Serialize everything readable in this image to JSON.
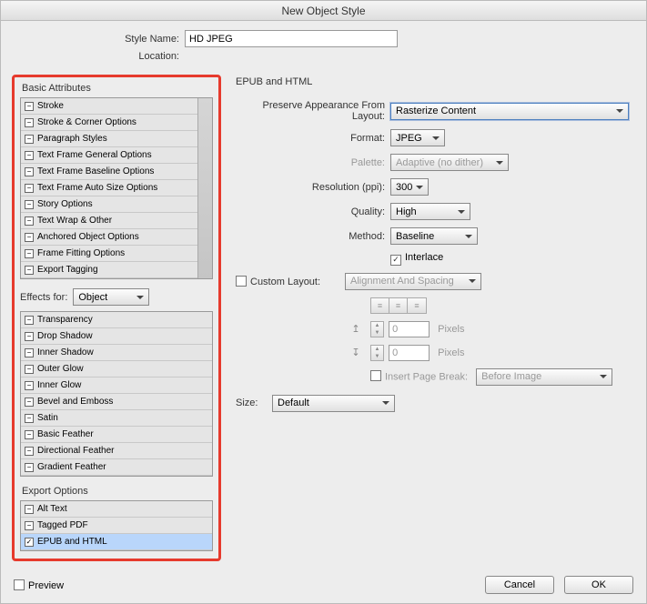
{
  "window": {
    "title": "New Object Style"
  },
  "top": {
    "style_name_label": "Style Name:",
    "style_name_value": "HD JPEG",
    "location_label": "Location:"
  },
  "sidebar": {
    "basic_title": "Basic Attributes",
    "basic_items": [
      {
        "label": "Stroke",
        "mark": "-"
      },
      {
        "label": "Stroke & Corner Options",
        "mark": "-"
      },
      {
        "label": "Paragraph Styles",
        "mark": "-"
      },
      {
        "label": "Text Frame General Options",
        "mark": "-"
      },
      {
        "label": "Text Frame Baseline Options",
        "mark": "-"
      },
      {
        "label": "Text Frame Auto Size Options",
        "mark": "-"
      },
      {
        "label": "Story Options",
        "mark": "-"
      },
      {
        "label": "Text Wrap & Other",
        "mark": "-"
      },
      {
        "label": "Anchored Object Options",
        "mark": "-"
      },
      {
        "label": "Frame Fitting Options",
        "mark": "-"
      },
      {
        "label": "Export Tagging",
        "mark": "-"
      }
    ],
    "effects_for_label": "Effects for:",
    "effects_for_value": "Object",
    "effect_items": [
      {
        "label": "Transparency",
        "mark": "-"
      },
      {
        "label": "Drop Shadow",
        "mark": "-"
      },
      {
        "label": "Inner Shadow",
        "mark": "-"
      },
      {
        "label": "Outer Glow",
        "mark": "-"
      },
      {
        "label": "Inner Glow",
        "mark": "-"
      },
      {
        "label": "Bevel and Emboss",
        "mark": "-"
      },
      {
        "label": "Satin",
        "mark": "-"
      },
      {
        "label": "Basic Feather",
        "mark": "-"
      },
      {
        "label": "Directional Feather",
        "mark": "-"
      },
      {
        "label": "Gradient Feather",
        "mark": "-"
      }
    ],
    "export_title": "Export Options",
    "export_items": [
      {
        "label": "Alt Text",
        "mark": "-",
        "selected": false
      },
      {
        "label": "Tagged PDF",
        "mark": "-",
        "selected": false
      },
      {
        "label": "EPUB and HTML",
        "mark": "✓",
        "selected": true
      }
    ]
  },
  "panel": {
    "title": "EPUB and HTML",
    "preserve_label": "Preserve Appearance From Layout:",
    "preserve_value": "Rasterize Content",
    "format_label": "Format:",
    "format_value": "JPEG",
    "palette_label": "Palette:",
    "palette_value": "Adaptive (no dither)",
    "resolution_label": "Resolution (ppi):",
    "resolution_value": "300",
    "quality_label": "Quality:",
    "quality_value": "High",
    "method_label": "Method:",
    "method_value": "Baseline",
    "interlace_label": "Interlace",
    "custom_layout_label": "Custom Layout:",
    "custom_layout_value": "Alignment And Spacing",
    "space_before_value": "0",
    "space_after_value": "0",
    "pixels_label": "Pixels",
    "insert_break_label": "Insert Page Break:",
    "insert_break_value": "Before Image",
    "size_label": "Size:",
    "size_value": "Default"
  },
  "footer": {
    "preview_label": "Preview",
    "cancel": "Cancel",
    "ok": "OK"
  }
}
